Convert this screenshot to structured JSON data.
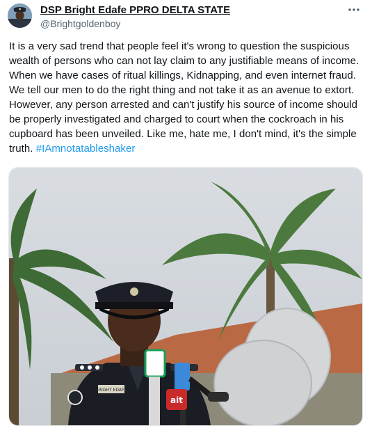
{
  "author": {
    "display_name": "DSP Bright Edafe PPRO DELTA STATE",
    "handle": "@Brightgoldenboy",
    "avatar_icon": "police-officer-avatar"
  },
  "tweet": {
    "text": "It is a very sad trend that people feel it's wrong to question the suspicious wealth of persons who can not lay claim to any justifiable means of income. When we have cases of ritual killings, Kidnapping, and even internet fraud. We tell our men to do the right thing and not take it as an avenue to extort. However, any person arrested and can't justify his source of income should be properly investigated and charged to court when the cockroach in his cupboard has been unveiled. Like me, hate me, I don't mind, it's the simple truth.",
    "hashtag": "#IAmnotatableshaker"
  },
  "media": {
    "description_icon": "photo-officer-press-briefing",
    "name_tag": "BRIGHT EDAFE",
    "mic_label": "ait"
  },
  "menu": {
    "icon": "more-options-icon"
  },
  "colors": {
    "link": "#1d9bf0",
    "secondary_text": "#536471"
  }
}
